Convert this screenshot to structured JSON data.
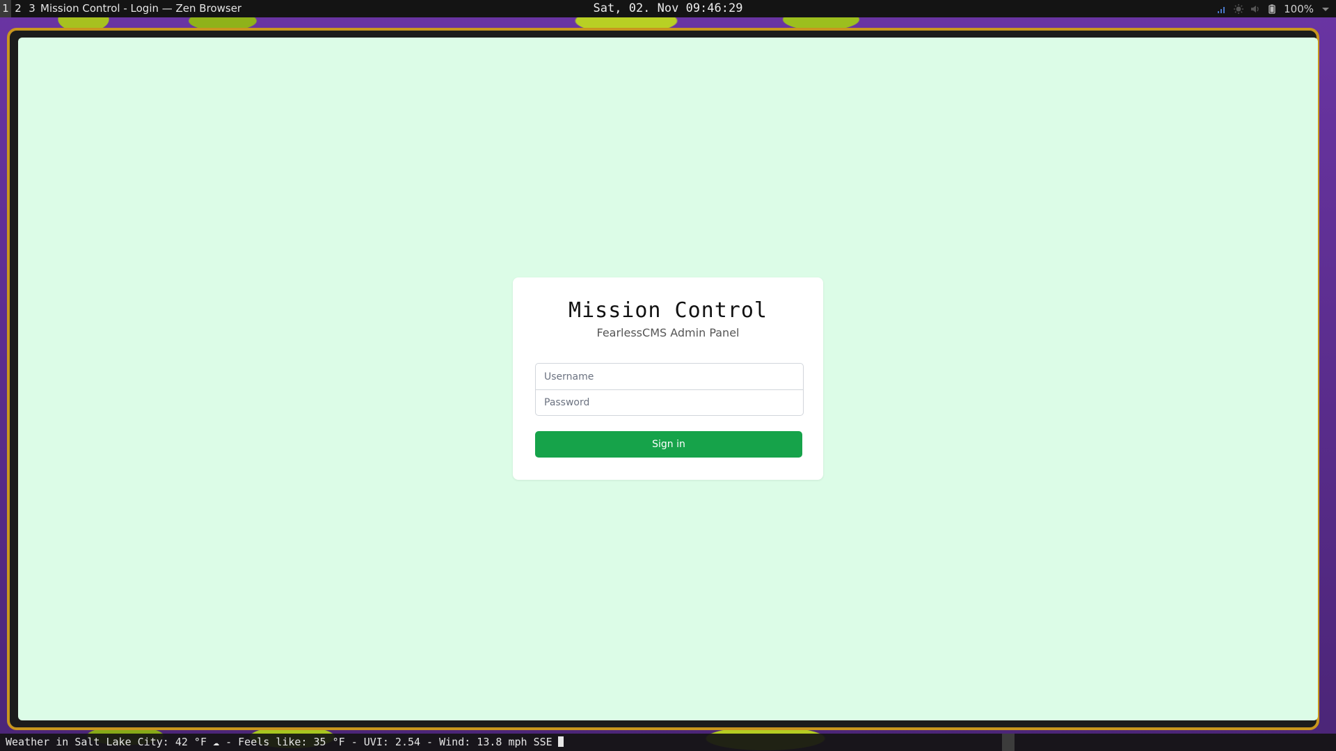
{
  "topbar": {
    "workspaces": [
      "1",
      "2",
      "3"
    ],
    "active_workspace": "1",
    "window_title": "Mission Control - Login — Zen Browser",
    "clock": "Sat, 02. Nov  09:46:29",
    "battery": "100%",
    "tray_icons": [
      "signal-icon",
      "brightness-icon",
      "volume-icon",
      "battery-icon",
      "chevron-down-icon"
    ]
  },
  "login": {
    "title": "Mission Control",
    "subtitle": "FearlessCMS Admin Panel",
    "username_placeholder": "Username",
    "password_placeholder": "Password",
    "username_value": "",
    "password_value": "",
    "submit_label": "Sign in"
  },
  "bottombar": {
    "weather": "Weather in Salt Lake City: 42 °F ☁ - Feels like: 35 °F - UVI: 2.54 - Wind: 13.8 mph SSE"
  },
  "colors": {
    "page_background": "#dcfce7",
    "button": "#16a34a",
    "frame_border": "#c8961e",
    "wallpaper": "#5a2d8c"
  }
}
